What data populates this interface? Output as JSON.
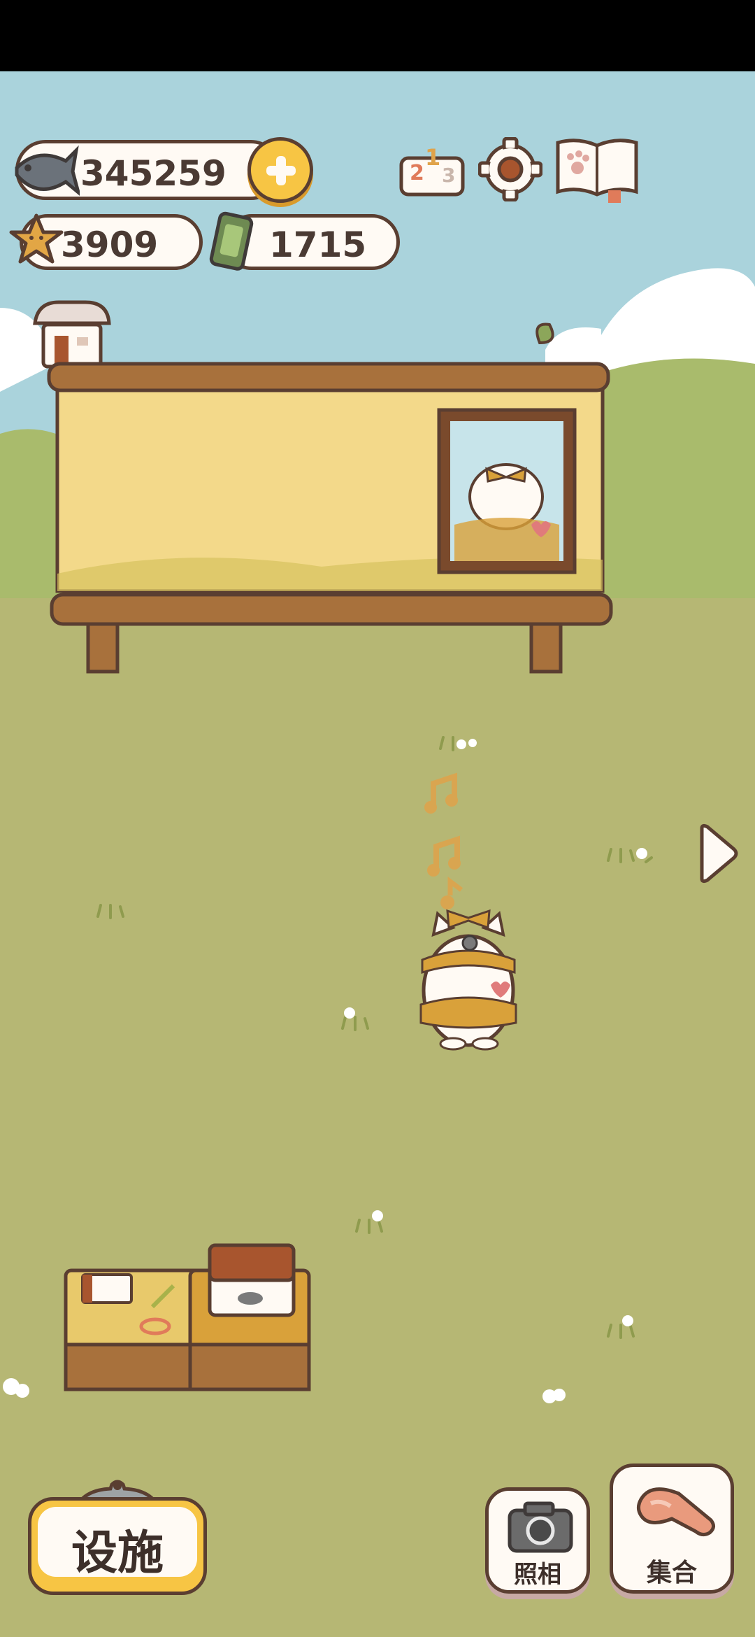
{
  "currency": {
    "fish": {
      "value": "345259",
      "icon": "fish-icon"
    },
    "star": {
      "value": "3909",
      "icon": "star-coin-icon"
    },
    "film": {
      "value": "1715",
      "icon": "film-roll-icon"
    }
  },
  "top_icons": [
    "add-currency-icon",
    "ranking-podium-icon",
    "settings-gear-icon",
    "paw-book-icon"
  ],
  "podium_digits": {
    "first": "1",
    "second": "2",
    "third": "3"
  },
  "buttons": {
    "facilities": "设施",
    "photo": "照相",
    "gather": "集合"
  },
  "colors": {
    "sky": "#aad3dc",
    "grass": "#b6b774",
    "outline": "#5a3e31",
    "board": "#f3d98a",
    "accent_yellow": "#f7c544",
    "button_bg": "#fffaf4"
  }
}
